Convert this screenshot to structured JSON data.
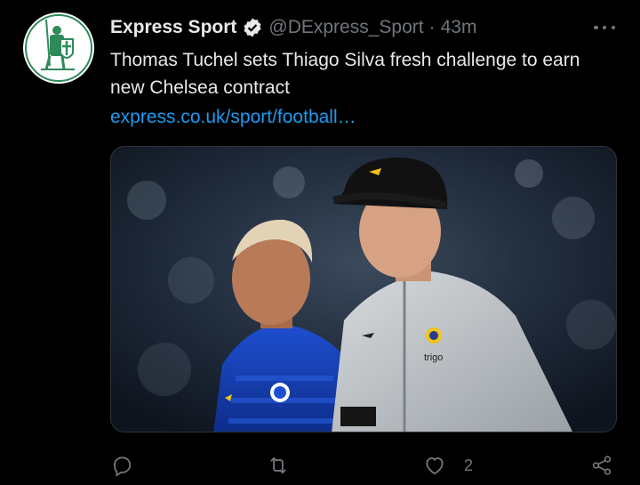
{
  "tweet": {
    "author_name": "Express Sport",
    "handle": "@DExpress_Sport",
    "separator": "·",
    "timestamp": "43m",
    "text": "Thomas Tuchel sets Thiago Silva fresh challenge to earn new Chelsea contract",
    "link": "express.co.uk/sport/football…",
    "media_alt_icon": "photo",
    "media_shirt_text": "trigo"
  },
  "actions": {
    "reply_icon": "reply-icon",
    "retweet_icon": "retweet-icon",
    "like_icon": "heart-icon",
    "like_count": "2",
    "share_icon": "share-icon"
  },
  "colors": {
    "background": "#000000",
    "text": "#e7e9ea",
    "muted": "#71767b",
    "link": "#1d9bf0",
    "avatar_green": "#2f8a5a"
  }
}
